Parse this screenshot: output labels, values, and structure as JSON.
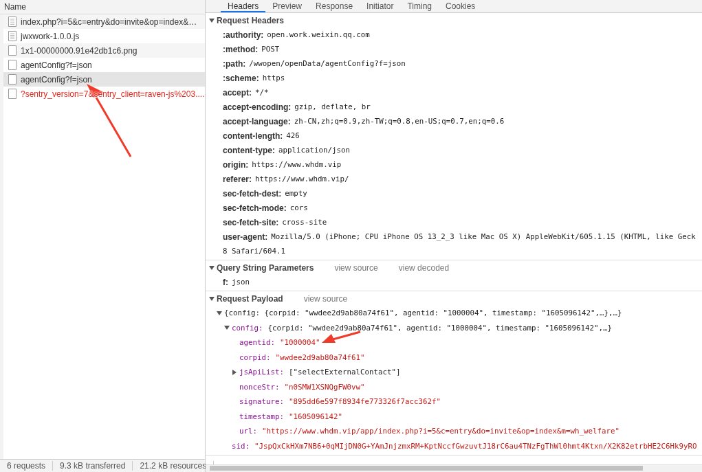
{
  "network_list": {
    "header": "Name",
    "requests": [
      {
        "name": "index.php?i=5&c=entry&do=invite&op=index&…",
        "kind": "document",
        "selected": false,
        "failed": false
      },
      {
        "name": "jwxwork-1.0.0.js",
        "kind": "document",
        "selected": false,
        "failed": false
      },
      {
        "name": "1x1-00000000.91e42db1c6.png",
        "kind": "file",
        "selected": false,
        "failed": false
      },
      {
        "name": "agentConfig?f=json",
        "kind": "file",
        "selected": false,
        "failed": false
      },
      {
        "name": "agentConfig?f=json",
        "kind": "file",
        "selected": true,
        "failed": false
      },
      {
        "name": "?sentry_version=7&sentry_client=raven-js%203....",
        "kind": "file",
        "selected": false,
        "failed": true
      }
    ]
  },
  "status_bar": [
    "6 requests",
    "9.3 kB transferred",
    "21.2 kB resources"
  ],
  "tabs": [
    {
      "label": "Headers",
      "selected": true
    },
    {
      "label": "Preview",
      "selected": false
    },
    {
      "label": "Response",
      "selected": false
    },
    {
      "label": "Initiator",
      "selected": false
    },
    {
      "label": "Timing",
      "selected": false
    },
    {
      "label": "Cookies",
      "selected": false
    }
  ],
  "sections": [
    {
      "kind": "headers",
      "title": "Request Headers",
      "expanded": true,
      "rows": [
        {
          "key": ":authority:",
          "value": "open.work.weixin.qq.com"
        },
        {
          "key": ":method:",
          "value": "POST"
        },
        {
          "key": ":path:",
          "value": "/wwopen/openData/agentConfig?f=json"
        },
        {
          "key": ":scheme:",
          "value": "https"
        },
        {
          "key": "accept:",
          "value": "*/*"
        },
        {
          "key": "accept-encoding:",
          "value": "gzip, deflate, br"
        },
        {
          "key": "accept-language:",
          "value": "zh-CN,zh;q=0.9,zh-TW;q=0.8,en-US;q=0.7,en;q=0.6"
        },
        {
          "key": "content-length:",
          "value": "426"
        },
        {
          "key": "content-type:",
          "value": "application/json"
        },
        {
          "key": "origin:",
          "value": "https://www.whdm.vip"
        },
        {
          "key": "referer:",
          "value": "https://www.whdm.vip/"
        },
        {
          "key": "sec-fetch-dest:",
          "value": "empty"
        },
        {
          "key": "sec-fetch-mode:",
          "value": "cors"
        },
        {
          "key": "sec-fetch-site:",
          "value": "cross-site"
        },
        {
          "key": "user-agent:",
          "value": "Mozilla/5.0 (iPhone; CPU iPhone OS 13_2_3 like Mac OS X) AppleWebKit/605.1.15 (KHTML, like Geck",
          "continuation": "8 Safari/604.1"
        }
      ]
    },
    {
      "kind": "headers",
      "title": "Query String Parameters",
      "expanded": true,
      "links": [
        "view source",
        "view decoded"
      ],
      "rows": [
        {
          "key": "f:",
          "value": "json"
        }
      ]
    },
    {
      "kind": "tree",
      "title": "Request Payload",
      "expanded": true,
      "links": [
        "view source"
      ],
      "tree": [
        {
          "preview": "{config: {corpid: \"wwdee2d9ab80a74f61\", agentid: \"1000004\", timestamp: \"1605096142\",…},…}",
          "expanded": true,
          "children": [
            {
              "key": "config:",
              "preview": "{corpid: \"wwdee2d9ab80a74f61\", agentid: \"1000004\", timestamp: \"1605096142\",…}",
              "expanded": true,
              "children": [
                {
                  "key": "agentid:",
                  "value": "\"1000004\""
                },
                {
                  "key": "corpid:",
                  "value": "\"wwdee2d9ab80a74f61\""
                },
                {
                  "key": "jsApiList:",
                  "preview": "[\"selectExternalContact\"]",
                  "expanded": false
                },
                {
                  "key": "nonceStr:",
                  "value": "\"n0SMW1XSNQgFW0vw\""
                },
                {
                  "key": "signature:",
                  "value": "\"895dd6e597f8934fe773326f7acc362f\""
                },
                {
                  "key": "timestamp:",
                  "value": "\"1605096142\""
                },
                {
                  "key": "url:",
                  "value": "\"https://www.whdm.vip/app/index.php?i=5&c=entry&do=invite&op=index&m=wh_welfare\""
                }
              ]
            },
            {
              "key": "sid:",
              "value": "\"JspQxCkHXm7NB6+0qMIjDN0G+YAmJnjzmxRM+KptNccfGwzuvtJ18rC6au4TNzFgThWl0hmt4Ktxn/X2K82etrbHE2C6Hk9yRO"
            }
          ]
        }
      ]
    }
  ],
  "annotations": [
    {
      "kind": "arrow"
    },
    {
      "kind": "arrow"
    }
  ]
}
